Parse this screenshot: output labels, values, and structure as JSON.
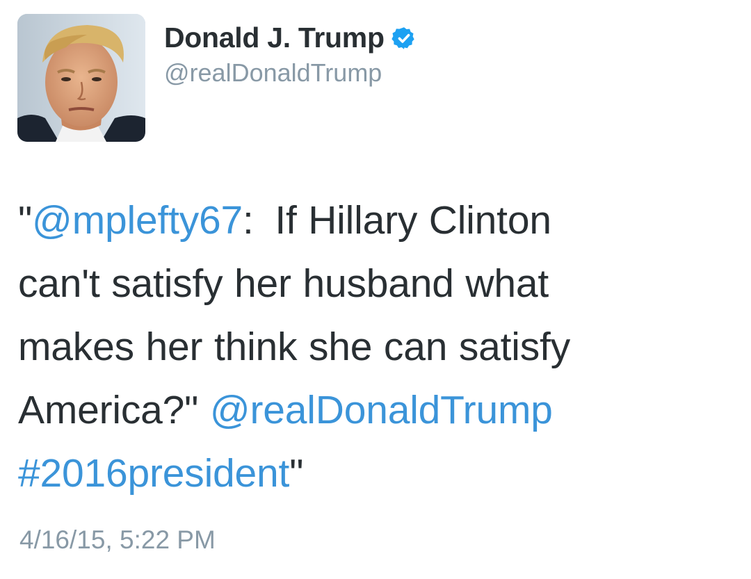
{
  "author": {
    "display_name": "Donald J. Trump",
    "handle": "@realDonaldTrump",
    "verified": true,
    "verified_icon": "verified-badge-icon",
    "avatar_icon": "profile-photo-avatar"
  },
  "tweet": {
    "line1": {
      "quote_open": "\"",
      "mention": "@mplefty67",
      "after_mention": ":",
      "text": "If Hillary Clinton"
    },
    "line2": "can't satisfy her husband what",
    "line3": "makes her think she can satisfy",
    "line4": {
      "text": "America?\" ",
      "mention": "@realDonaldTrump"
    },
    "line5": {
      "hashtag": "#2016president",
      "quote_close": "\""
    }
  },
  "timestamp": "4/16/15, 5:22 PM",
  "colors": {
    "text": "#292f33",
    "link": "#3b94d9",
    "muted": "#8899a6",
    "verified_badge": "#1da1f2",
    "background": "#ffffff"
  }
}
